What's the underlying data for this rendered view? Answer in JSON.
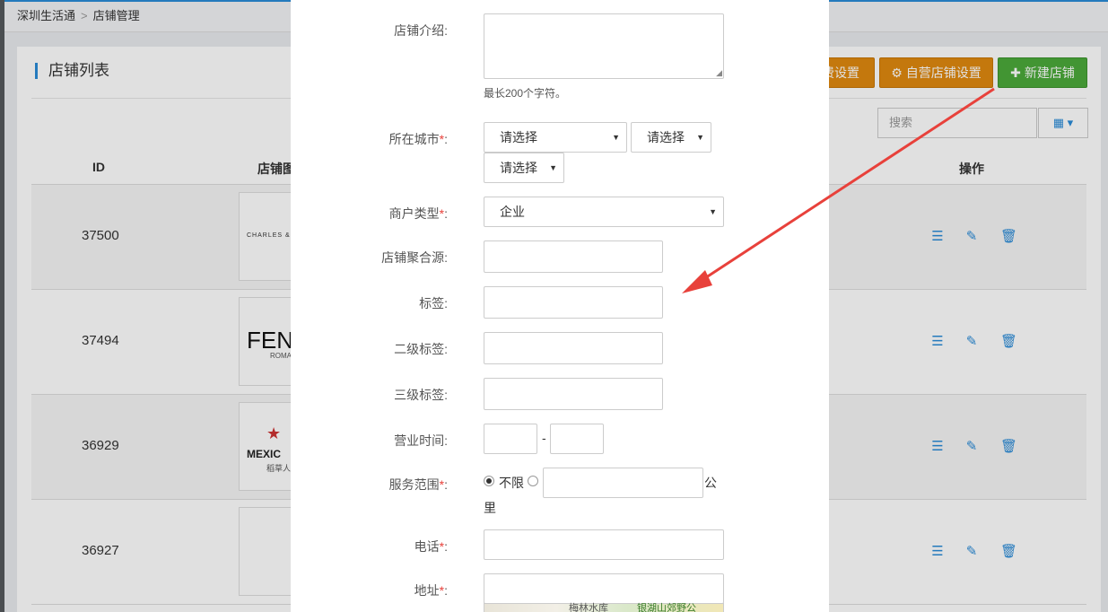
{
  "breadcrumb": {
    "root": "深圳生活通",
    "separator": ">",
    "current": "店铺管理"
  },
  "panel": {
    "title": "店铺列表"
  },
  "toolbar": {
    "fee_settings_label": "费设置",
    "self_store_label": "自营店铺设置",
    "new_store_label": "新建店铺",
    "self_store_icon": "gear-icon",
    "new_store_icon": "plus-icon"
  },
  "search": {
    "placeholder": "搜索"
  },
  "table": {
    "headers": {
      "id": "ID",
      "image": "店铺图",
      "actions": "操作"
    },
    "rows": [
      {
        "id": "37500",
        "logo_text": "CHARLES &",
        "logo_sub": ""
      },
      {
        "id": "37494",
        "logo_text": "FEN",
        "logo_sub": "ROMA"
      },
      {
        "id": "36929",
        "logo_text": "MEXIC",
        "logo_sub": "稻草人"
      },
      {
        "id": "36927",
        "logo_text": "",
        "logo_sub": ""
      }
    ]
  },
  "form": {
    "intro_label": "店铺介绍:",
    "intro_hint": "最长200个字符。",
    "city_label": "所在城市",
    "city_select_1": "请选择",
    "city_select_2": "请选择",
    "city_select_3": "请选择",
    "merchant_type_label": "商户类型",
    "merchant_type_value": "企业",
    "aggregate_label": "店铺聚合源:",
    "tag_label": "标签:",
    "tag2_label": "二级标签:",
    "tag3_label": "三级标签:",
    "hours_label": "营业时间:",
    "hours_sep": "-",
    "range_label": "服务范围",
    "range_unlimited": "不限",
    "range_unit_1": "公",
    "range_unit_2": "里",
    "phone_label": "电话",
    "address_label": "地址",
    "req_mark": "*",
    "colon": ":",
    "map_text": "银湖山郊野公",
    "map_text_2": "梅林水库"
  },
  "colors": {
    "accent": "#2a8bd8",
    "orange_button": "#e0890f",
    "green_button": "#4caa3b",
    "required": "#e8413b",
    "arrow": "#e8413b"
  }
}
